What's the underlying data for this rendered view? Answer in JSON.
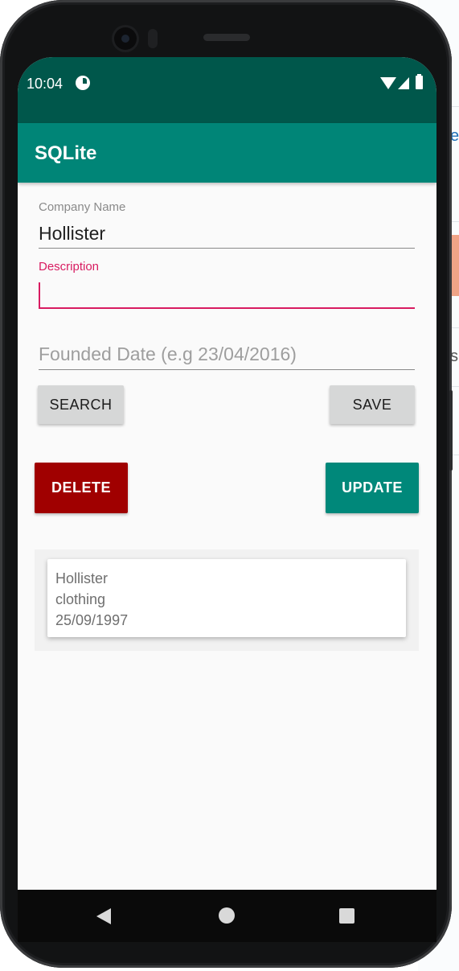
{
  "status_bar": {
    "time": "10:04"
  },
  "app_bar": {
    "title": "SQLite"
  },
  "form": {
    "company_name": {
      "label": "Company Name",
      "value": "Hollister"
    },
    "description": {
      "label": "Description",
      "value": ""
    },
    "founded_date": {
      "placeholder": "Founded Date (e.g 23/04/2016)",
      "value": ""
    }
  },
  "buttons": {
    "search": "SEARCH",
    "save": "SAVE",
    "delete": "DELETE",
    "update": "UPDATE"
  },
  "list": {
    "items": [
      {
        "name": "Hollister",
        "description": "clothing",
        "founded": "25/09/1997"
      }
    ]
  },
  "background_window": {
    "fragment_1": "e",
    "fragment_2": "s"
  },
  "colors": {
    "primary": "#008577",
    "primary_dark": "#00574b",
    "accent": "#d81b60",
    "delete": "#a00000"
  },
  "icons": [
    "status-app-icon",
    "wifi-icon",
    "signal-icon",
    "battery-icon",
    "nav-back-icon",
    "nav-home-icon",
    "nav-recents-icon"
  ]
}
